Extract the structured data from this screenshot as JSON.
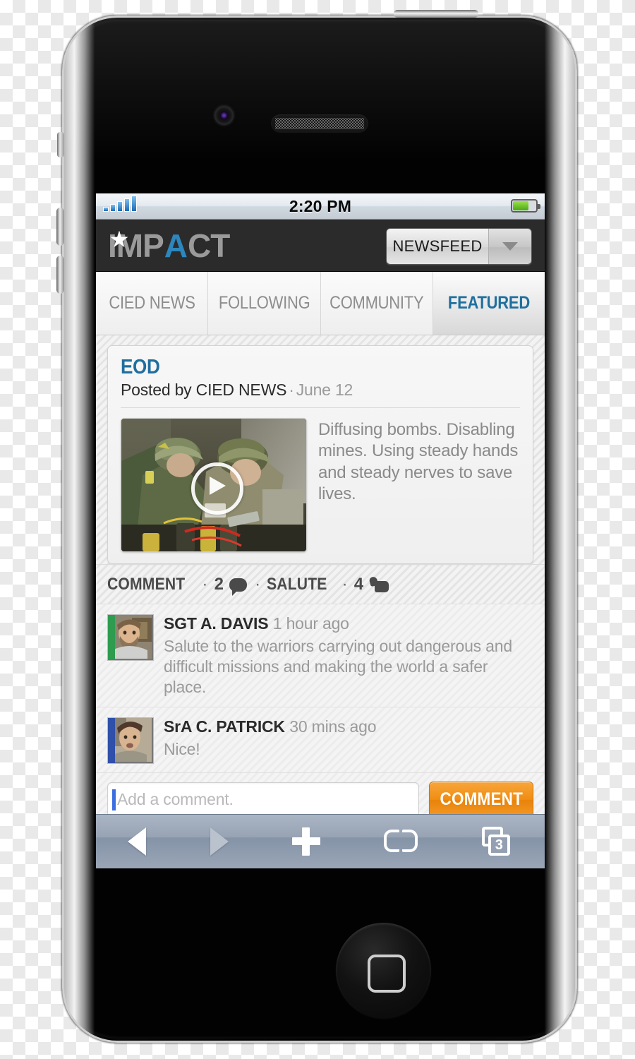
{
  "status_bar": {
    "time": "2:20 PM",
    "signal_icon": "signal-bars-icon",
    "battery_icon": "battery-icon",
    "signal_bars": 5,
    "battery_percent": 64
  },
  "app_header": {
    "logo_part1": "IMP",
    "logo_accent": "A",
    "logo_part2": "CT",
    "logo_full": "IMPACT",
    "star_icon": "star-icon",
    "dropdown_label": "NEWSFEED",
    "dropdown_icon": "chevron-down-icon"
  },
  "tabs": [
    {
      "label": "CIED NEWS",
      "active": false
    },
    {
      "label": "FOLLOWING",
      "active": false
    },
    {
      "label": "COMMUNITY",
      "active": false
    },
    {
      "label": "FEATURED",
      "active": true
    }
  ],
  "post": {
    "title": "EOD",
    "posted_by_prefix": "Posted by CIED NEWS",
    "meta_separator": "·",
    "date": "June 12",
    "description": "Diffusing bombs. Disabling mines. Using steady hands and steady nerves to save lives.",
    "video": {
      "play_icon": "play-icon",
      "alt": "Two soldiers in camouflage uniforms defusing explosive ordnance"
    }
  },
  "actions": {
    "comment_label": "COMMENT",
    "comment_count": "2",
    "comment_icon": "speech-bubble-icon",
    "separator": "·",
    "salute_label": "SALUTE",
    "salute_count": "4",
    "salute_icon": "thumbs-up-icon"
  },
  "comments": [
    {
      "name": "SGT A. DAVIS",
      "time": "1 hour ago",
      "text": "Salute to the warriors carrying out dangerous and difficult missions and making the world a safer place.",
      "avatar_stripe": "#2e9b4f"
    },
    {
      "name": "SrA C. PATRICK",
      "time": "30 mins ago",
      "text": "Nice!",
      "avatar_stripe": "#2f4fa8"
    }
  ],
  "comment_input": {
    "value": "",
    "placeholder": "Add a comment.",
    "submit_label": "COMMENT"
  },
  "browser_toolbar": {
    "back_icon": "back-arrow-icon",
    "forward_icon": "forward-arrow-icon",
    "share_icon": "plus-icon",
    "bookmarks_icon": "book-icon",
    "tabs_icon": "tabs-icon",
    "tab_count": "3"
  },
  "device": {
    "camera_icon": "front-camera-icon",
    "earpiece_icon": "earpiece-speaker-icon",
    "home_button_icon": "home-button-icon",
    "power_button_icon": "power-button-icon",
    "mute_switch_icon": "mute-switch-icon",
    "volume_up_icon": "volume-up-button-icon",
    "volume_down_icon": "volume-down-button-icon"
  },
  "colors": {
    "accent_blue": "#1f6f9e",
    "logo_blue": "#2d86bd",
    "orange_button": "#ef8d12",
    "header_dark": "#2b2b2b"
  }
}
